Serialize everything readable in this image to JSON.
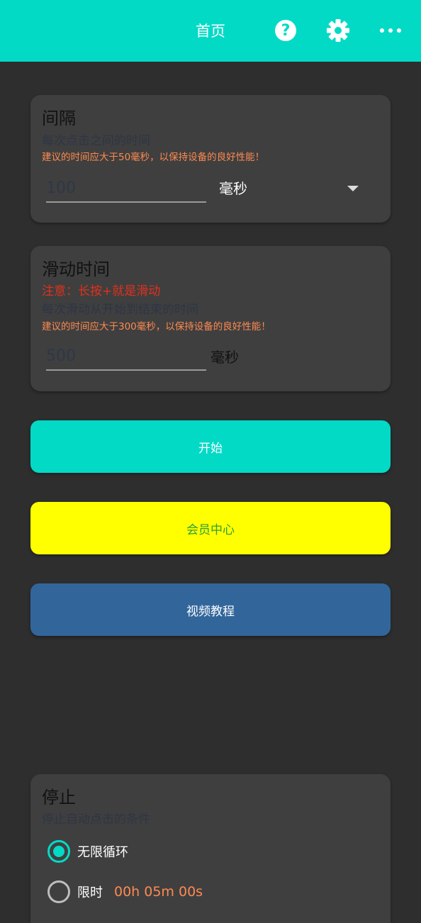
{
  "colors": {
    "accent": "#03dac6",
    "background": "#2e2e2e",
    "card": "#3f3f3f",
    "warning": "#ff8a50",
    "note": "#e2301c",
    "vip_button": "#ffff00",
    "video_button": "#32669b"
  },
  "header": {
    "title": "首页",
    "icons": [
      "help-icon",
      "gear-icon",
      "more-icon"
    ]
  },
  "interval": {
    "title": "间隔",
    "desc": "每次点击之间的时间",
    "warning": "建议的时间应大于50毫秒，以保持设备的良好性能！",
    "placeholder": "100",
    "unit": "毫秒"
  },
  "swipe": {
    "title": "滑动时间",
    "note": "注意：长按+就是滑动",
    "desc": "每次滑动从开始到结束的时间",
    "warning": "建议的时间应大于300毫秒，以保持设备的良好性能！",
    "placeholder": "500",
    "unit": "毫秒"
  },
  "buttons": {
    "start": "开始",
    "vip": "会员中心",
    "video": "视频教程"
  },
  "stop": {
    "title": "停止",
    "desc": "停止自动点击的条件",
    "options": [
      {
        "label": "无限循环",
        "checked": true
      },
      {
        "label": "限时",
        "checked": false,
        "value": "00h 05m 00s"
      }
    ]
  }
}
